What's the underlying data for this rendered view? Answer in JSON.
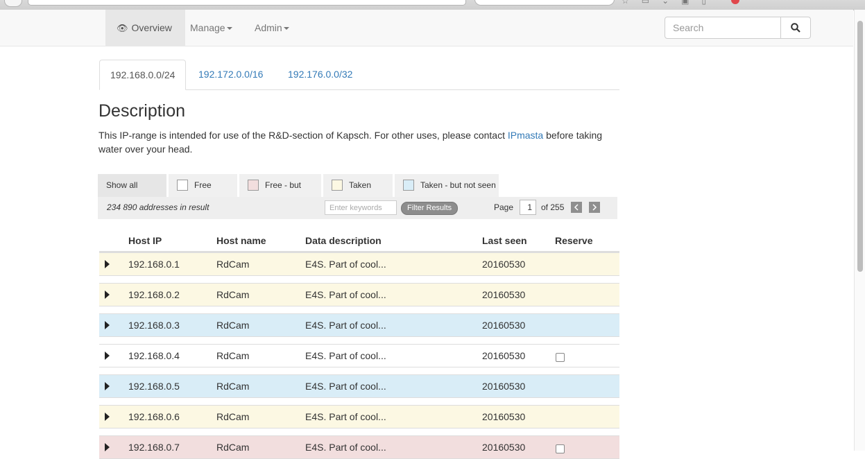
{
  "nav": {
    "overview_label": "Overview",
    "manage_label": "Manage",
    "admin_label": "Admin",
    "search_placeholder": "Search"
  },
  "tabs": [
    {
      "label": "192.168.0.0/24",
      "active": true
    },
    {
      "label": "192.172.0.0/16",
      "active": false
    },
    {
      "label": "192.176.0.0/32",
      "active": false
    }
  ],
  "description": {
    "title": "Description",
    "text_before": "This IP-range is intended for use of the R&D-section of Kapsch. For other uses, please contact ",
    "link": "IPmasta",
    "text_after": " before taking water over your head."
  },
  "legend": {
    "show_all": "Show all",
    "free": "Free",
    "free_seen": "Free - but seen",
    "taken": "Taken",
    "taken_not_seen": "Taken - but not seen",
    "colors": {
      "free": "#ffffff",
      "free_seen": "#f2dede",
      "taken": "#fcf8e3",
      "taken_not_seen": "#d9edf7"
    }
  },
  "filter": {
    "count": "234 890 addresses in result",
    "keyword_placeholder": "Enter keywords",
    "filter_button": "Filter Results",
    "page_label": "Page",
    "page_value": "1",
    "page_of": "of 255"
  },
  "table": {
    "headers": {
      "ip": "Host IP",
      "name": "Host name",
      "desc": "Data description",
      "seen": "Last seen",
      "reserve": "Reserve"
    },
    "rows": [
      {
        "ip": "192.168.0.1",
        "name": "RdCam",
        "desc": "E4S. Part of cool...",
        "seen": "20160530",
        "status": "taken",
        "reservable": false
      },
      {
        "ip": "192.168.0.2",
        "name": "RdCam",
        "desc": "E4S. Part of cool...",
        "seen": "20160530",
        "status": "taken",
        "reservable": false
      },
      {
        "ip": "192.168.0.3",
        "name": "RdCam",
        "desc": "E4S. Part of cool...",
        "seen": "20160530",
        "status": "taken_not_seen",
        "reservable": false
      },
      {
        "ip": "192.168.0.4",
        "name": "RdCam",
        "desc": "E4S. Part of cool...",
        "seen": "20160530",
        "status": "free",
        "reservable": true
      },
      {
        "ip": "192.168.0.5",
        "name": "RdCam",
        "desc": "E4S. Part of cool...",
        "seen": "20160530",
        "status": "taken_not_seen",
        "reservable": false
      },
      {
        "ip": "192.168.0.6",
        "name": "RdCam",
        "desc": "E4S. Part of cool...",
        "seen": "20160530",
        "status": "taken",
        "reservable": false
      },
      {
        "ip": "192.168.0.7",
        "name": "RdCam",
        "desc": "E4S. Part of cool...",
        "seen": "20160530",
        "status": "free_seen",
        "reservable": true
      }
    ]
  }
}
